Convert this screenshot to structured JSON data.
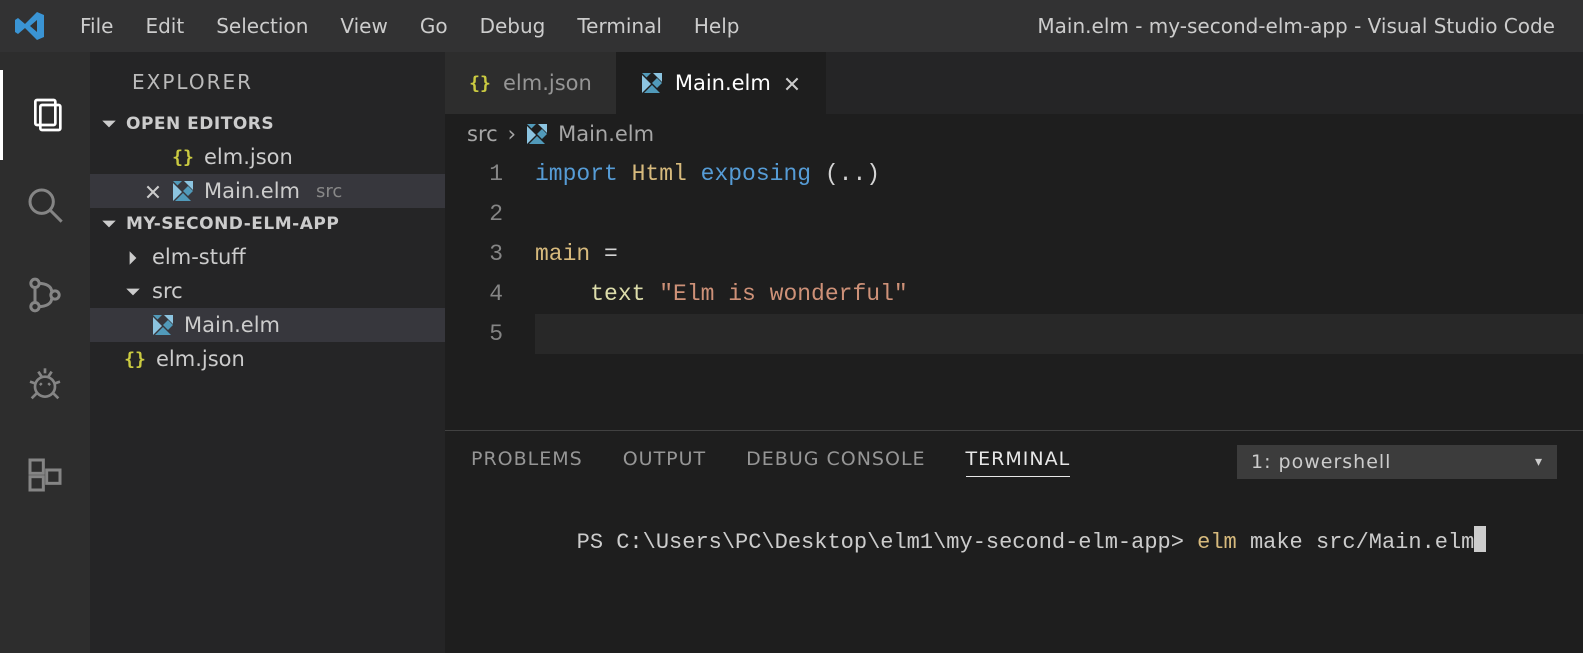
{
  "menubar": {
    "items": [
      "File",
      "Edit",
      "Selection",
      "View",
      "Go",
      "Debug",
      "Terminal",
      "Help"
    ]
  },
  "window_title": "Main.elm - my-second-elm-app - Visual Studio Code",
  "activitybar": {
    "items": [
      {
        "name": "explorer-icon",
        "active": true
      },
      {
        "name": "search-icon",
        "active": false
      },
      {
        "name": "source-control-icon",
        "active": false
      },
      {
        "name": "debug-icon",
        "active": false
      },
      {
        "name": "extensions-icon",
        "active": false
      }
    ]
  },
  "sidebar": {
    "title": "EXPLORER",
    "open_editors": {
      "label": "OPEN EDITORS",
      "items": [
        {
          "file": "elm.json",
          "type": "json",
          "active": false,
          "dirty": false,
          "dim": ""
        },
        {
          "file": "Main.elm",
          "type": "elm",
          "active": true,
          "dirty": false,
          "dim": "src"
        }
      ]
    },
    "workspace": {
      "label": "MY-SECOND-ELM-APP",
      "tree": [
        {
          "kind": "folder",
          "name": "elm-stuff",
          "expanded": false,
          "depth": 1
        },
        {
          "kind": "folder",
          "name": "src",
          "expanded": true,
          "depth": 1
        },
        {
          "kind": "file",
          "name": "Main.elm",
          "type": "elm",
          "depth": 2,
          "active": true
        },
        {
          "kind": "file",
          "name": "elm.json",
          "type": "json",
          "depth": 1,
          "active": false
        }
      ]
    }
  },
  "tabs": [
    {
      "file": "elm.json",
      "type": "json",
      "active": false
    },
    {
      "file": "Main.elm",
      "type": "elm",
      "active": true
    }
  ],
  "breadcrumbs": {
    "segments": [
      "src",
      "Main.elm"
    ],
    "file_type": "elm"
  },
  "editor": {
    "lines": [
      {
        "n": 1,
        "tokens": [
          [
            "kw",
            "import "
          ],
          [
            "name",
            "Html "
          ],
          [
            "kw",
            "exposing "
          ],
          [
            "op",
            "(..)"
          ]
        ]
      },
      {
        "n": 2,
        "tokens": []
      },
      {
        "n": 3,
        "tokens": [
          [
            "name",
            "main "
          ],
          [
            "op",
            "="
          ]
        ]
      },
      {
        "n": 4,
        "tokens": [
          [
            "plain",
            "    "
          ],
          [
            "fn",
            "text "
          ],
          [
            "str",
            "\"Elm is wonderful\""
          ]
        ]
      },
      {
        "n": 5,
        "tokens": [],
        "current": true
      }
    ]
  },
  "panel": {
    "tabs": [
      "PROBLEMS",
      "OUTPUT",
      "DEBUG CONSOLE",
      "TERMINAL"
    ],
    "active_tab": "TERMINAL",
    "terminal_selector": "1: powershell",
    "terminal": {
      "prompt": "PS C:\\Users\\PC\\Desktop\\elm1\\my-second-elm-app> ",
      "cmd_highlight": "elm",
      "cmd_rest": " make src/Main.elm"
    }
  }
}
